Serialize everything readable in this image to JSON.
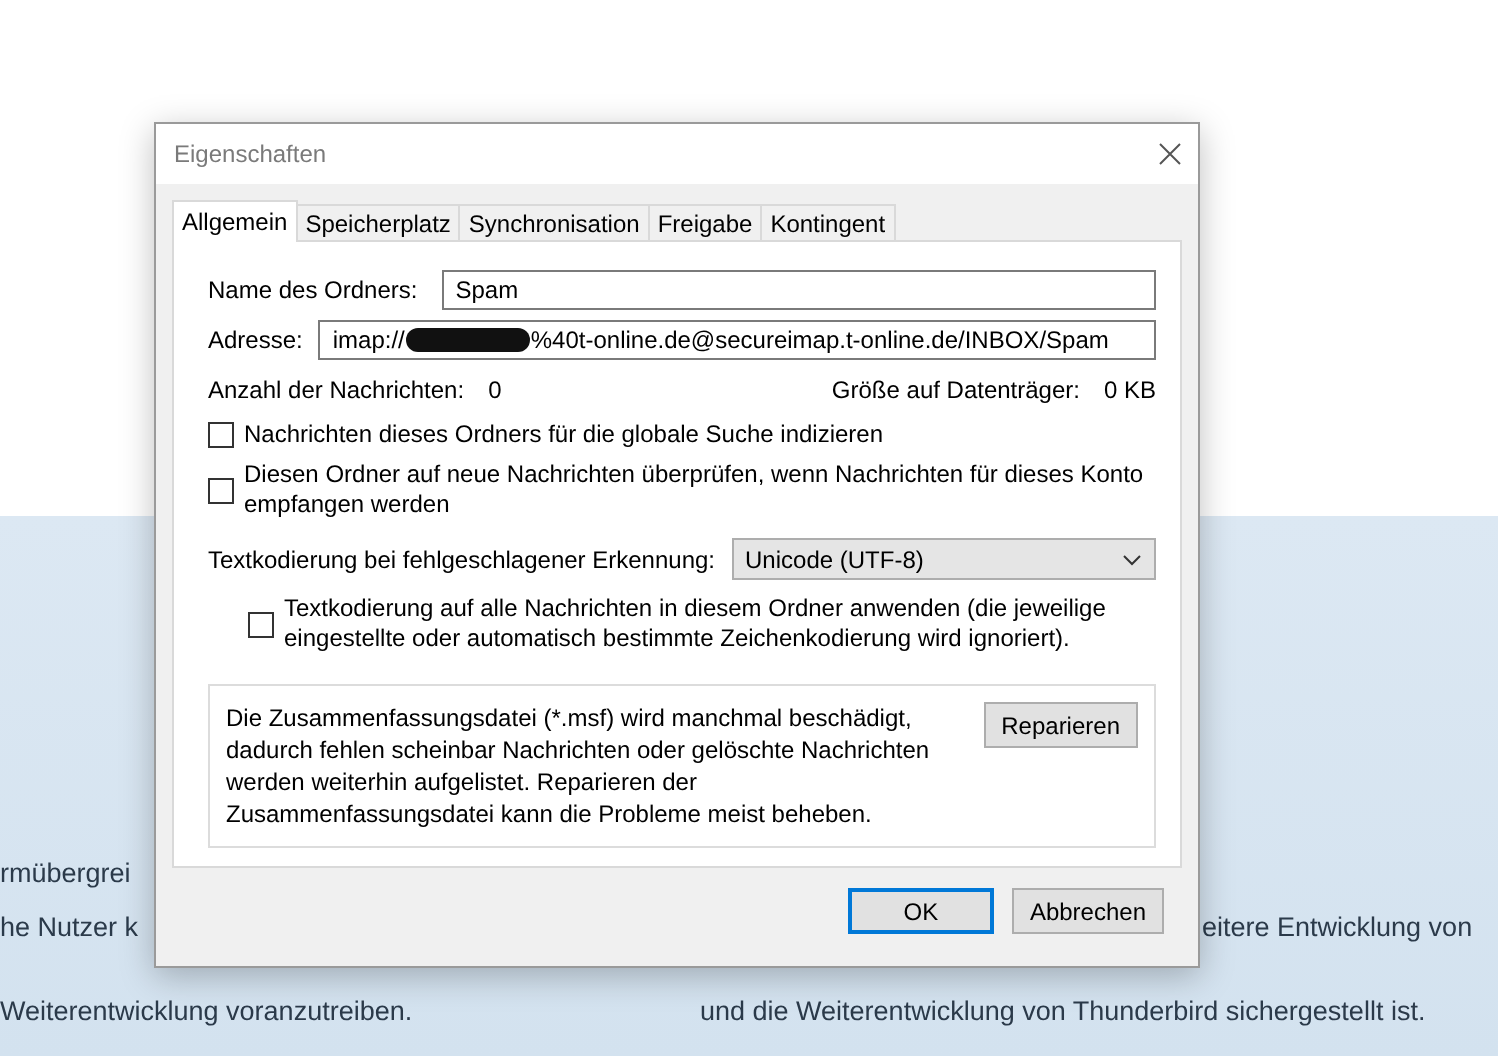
{
  "background": {
    "left_lines": [
      "rmübergrei",
      "he Nutzer k",
      "Weiterentwicklung voranzutreiben."
    ],
    "right_lines": [
      "eitere Entwicklung von",
      "und die Weiterentwicklung von Thunderbird sichergestellt ist."
    ]
  },
  "dialog": {
    "title": "Eigenschaften",
    "tabs": [
      {
        "label": "Allgemein",
        "selected": true
      },
      {
        "label": "Speicherplatz",
        "selected": false
      },
      {
        "label": "Synchronisation",
        "selected": false
      },
      {
        "label": "Freigabe",
        "selected": false
      },
      {
        "label": "Kontingent",
        "selected": false
      }
    ],
    "folder_name": {
      "label": "Name des Ordners:",
      "value": "Spam"
    },
    "address": {
      "label": "Adresse:",
      "value_start": "imap://",
      "redacted": true,
      "value_end": "%40t-online.de@secureimap.t-online.de/INBOX/Spam"
    },
    "message_count": {
      "label": "Anzahl der Nachrichten:",
      "value": "0"
    },
    "disk_size": {
      "label": "Größe auf Datenträger:",
      "value": "0 KB"
    },
    "checkboxes": [
      {
        "label": "Nachrichten dieses Ordners für die globale Suche indizieren",
        "checked": false
      },
      {
        "label": "Diesen Ordner auf neue Nachrichten überprüfen, wenn Nachrichten für dieses Konto empfangen werden",
        "checked": false
      }
    ],
    "encoding": {
      "label": "Textkodierung bei fehlgeschlagener Erkennung:",
      "value": "Unicode (UTF-8)"
    },
    "apply_encoding": {
      "label": "Textkodierung auf alle Nachrichten in diesem Ordner anwenden (die jeweilige eingestellte oder automatisch bestimmte Zeichenkodierung wird ignoriert).",
      "checked": false
    },
    "repair": {
      "text": "Die Zusammenfassungsdatei (*.msf) wird manchmal beschädigt, dadurch fehlen scheinbar Nachrichten oder gelöschte Nachrichten werden weiterhin aufgelistet. Reparieren der Zusammenfassungsdatei kann die Probleme meist beheben.",
      "button": "Reparieren"
    },
    "buttons": [
      {
        "label": "OK",
        "default": true
      },
      {
        "label": "Abbrechen",
        "default": false
      }
    ]
  }
}
